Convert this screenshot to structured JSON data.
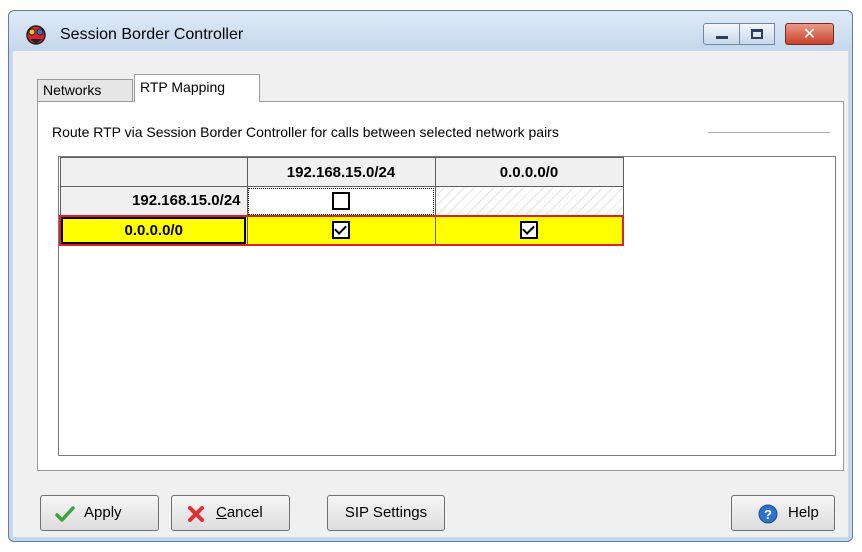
{
  "window": {
    "title": "Session Border Controller",
    "close_glyph": "✕"
  },
  "tabs": [
    {
      "label": "Networks",
      "selected": false
    },
    {
      "label": "RTP Mapping",
      "selected": true
    }
  ],
  "rtp_mapping": {
    "group_label": "Route RTP via Session Border Controller for calls between selected network pairs",
    "columns": [
      "192.168.15.0/24",
      "0.0.0.0/0"
    ],
    "rows": [
      {
        "label": "192.168.15.0/24",
        "cells": [
          false,
          null
        ],
        "selected": false
      },
      {
        "label": "0.0.0.0/0",
        "cells": [
          true,
          true
        ],
        "selected": true
      }
    ]
  },
  "buttons": {
    "apply": "Apply",
    "cancel": "Cancel",
    "sip_settings": "SIP Settings",
    "help": "Help"
  },
  "colors": {
    "selection_fill": "#ffff00",
    "selection_border": "#e02020",
    "titlebar": "#c5d7ec"
  },
  "icons": {
    "app": "sbc-app-icon",
    "apply": "check-icon",
    "cancel": "x-icon",
    "help": "help-icon"
  }
}
